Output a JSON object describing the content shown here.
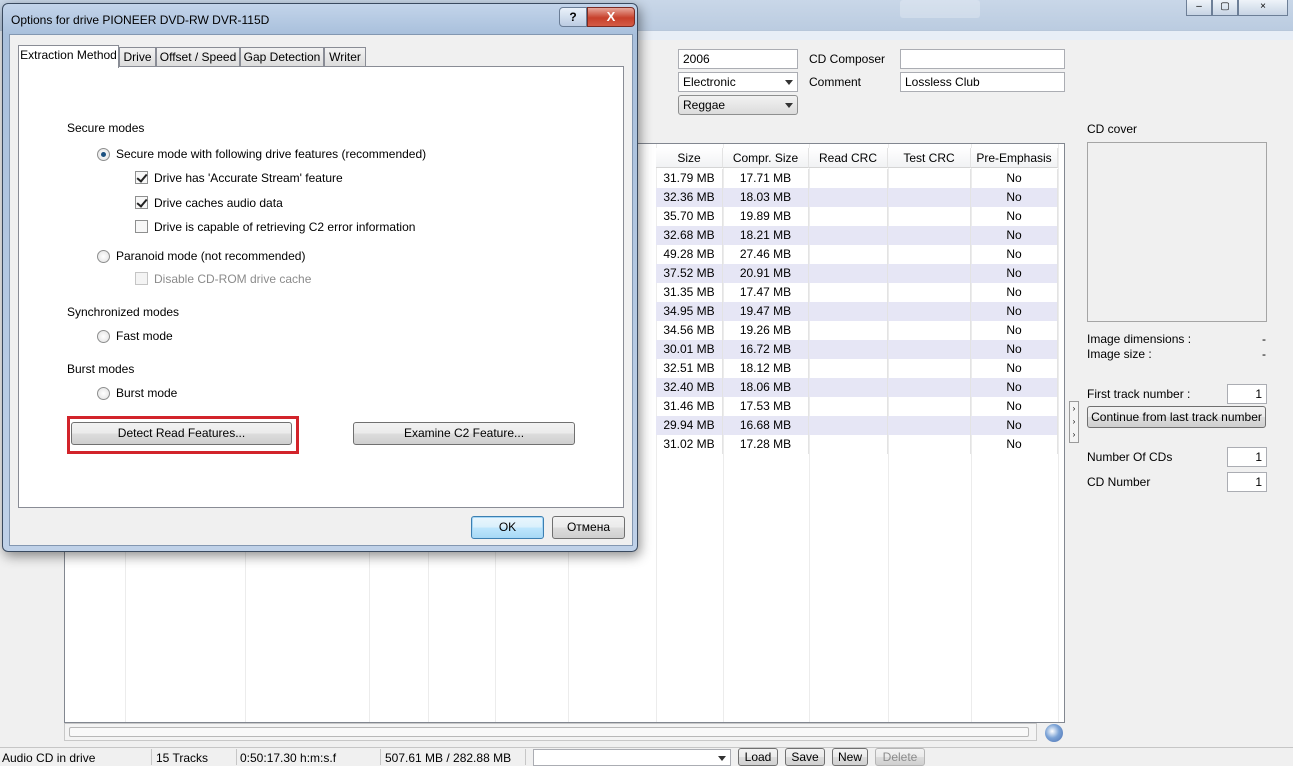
{
  "main": {
    "fields": {
      "year": "2006",
      "cd_composer_label": "CD Composer",
      "cd_composer": "",
      "genre1": "Electronic",
      "comment_label": "Comment",
      "comment": "Lossless Club",
      "genre2": "Reggae"
    },
    "table": {
      "columns": [
        "Size",
        "Compr. Size",
        "Read CRC",
        "Test CRC",
        "Pre-Emphasis"
      ],
      "rows": [
        [
          "31.79 MB",
          "17.71 MB",
          "",
          "",
          "No"
        ],
        [
          "32.36 MB",
          "18.03 MB",
          "",
          "",
          "No"
        ],
        [
          "35.70 MB",
          "19.89 MB",
          "",
          "",
          "No"
        ],
        [
          "32.68 MB",
          "18.21 MB",
          "",
          "",
          "No"
        ],
        [
          "49.28 MB",
          "27.46 MB",
          "",
          "",
          "No"
        ],
        [
          "37.52 MB",
          "20.91 MB",
          "",
          "",
          "No"
        ],
        [
          "31.35 MB",
          "17.47 MB",
          "",
          "",
          "No"
        ],
        [
          "34.95 MB",
          "19.47 MB",
          "",
          "",
          "No"
        ],
        [
          "34.56 MB",
          "19.26 MB",
          "",
          "",
          "No"
        ],
        [
          "30.01 MB",
          "16.72 MB",
          "",
          "",
          "No"
        ],
        [
          "32.51 MB",
          "18.12 MB",
          "",
          "",
          "No"
        ],
        [
          "32.40 MB",
          "18.06 MB",
          "",
          "",
          "No"
        ],
        [
          "31.46 MB",
          "17.53 MB",
          "",
          "",
          "No"
        ],
        [
          "29.94 MB",
          "16.68 MB",
          "",
          "",
          "No"
        ],
        [
          "31.02 MB",
          "17.28 MB",
          "",
          "",
          "No"
        ]
      ]
    },
    "right_panel": {
      "cd_cover_label": "CD cover",
      "image_dimensions_label": "Image dimensions :",
      "image_dimensions_value": "-",
      "image_size_label": "Image size :",
      "image_size_value": "-",
      "first_track_label": "First track number :",
      "first_track_value": "1",
      "continue_button": "Continue from last track number",
      "number_of_cds_label": "Number Of CDs",
      "number_of_cds_value": "1",
      "cd_number_label": "CD Number",
      "cd_number_value": "1"
    },
    "statusbar": {
      "drive_status": "Audio CD in drive",
      "tracks": "15 Tracks",
      "duration": "0:50:17.30 h:m:s.f",
      "sizes": "507.61 MB / 282.88 MB",
      "load": "Load",
      "save": "Save",
      "new": "New",
      "delete": "Delete"
    }
  },
  "dialog": {
    "title": "Options for drive PIONEER DVD-RW  DVR-115D",
    "help": "?",
    "close": "X",
    "tabs": [
      "Extraction Method",
      "Drive",
      "Offset / Speed",
      "Gap Detection",
      "Writer"
    ],
    "secure_modes_label": "Secure modes",
    "secure_mode_option": "Secure mode with following drive features (recommended)",
    "accurate_stream": "Drive has 'Accurate Stream' feature",
    "caches_audio": "Drive caches audio data",
    "c2_error": "Drive is capable of retrieving C2 error information",
    "paranoid_mode": "Paranoid mode (not recommended)",
    "disable_cache": "Disable CD-ROM drive cache",
    "synchronized_modes_label": "Synchronized modes",
    "fast_mode": "Fast mode",
    "burst_modes_label": "Burst modes",
    "burst_mode": "Burst mode",
    "detect_button": "Detect Read Features...",
    "examine_button": "Examine C2 Feature...",
    "ok_button": "OK",
    "cancel_button": "Отмена"
  }
}
